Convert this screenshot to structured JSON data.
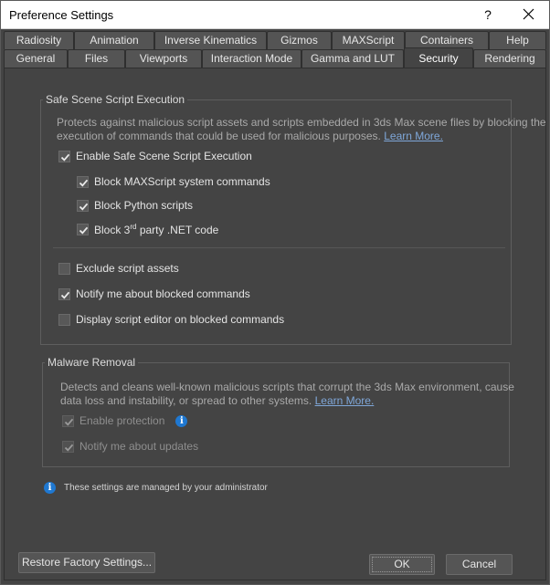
{
  "window": {
    "title": "Preference Settings",
    "help_label": "?"
  },
  "tabs": {
    "row1": [
      "Radiosity",
      "Animation",
      "Inverse Kinematics",
      "Gizmos",
      "MAXScript",
      "Containers",
      "Help"
    ],
    "row2": [
      "General",
      "Files",
      "Viewports",
      "Interaction Mode",
      "Gamma and LUT",
      "Security",
      "Rendering"
    ],
    "active": "Security"
  },
  "safe_scene": {
    "title": "Safe Scene Script Execution",
    "description_line1": "Protects against malicious script assets and scripts embedded in 3ds Max scene files by blocking the",
    "description_line2": "execution of commands that could be used for malicious purposes.",
    "learn_more": "Learn More.",
    "enable": {
      "label": "Enable Safe Scene Script Execution",
      "checked": true
    },
    "block_maxscript": {
      "label": "Block MAXScript system commands",
      "checked": true
    },
    "block_python": {
      "label": "Block Python scripts",
      "checked": true
    },
    "block_dotnet": {
      "label_pre": "Block 3",
      "label_sup": "rd",
      "label_post": " party .NET code",
      "checked": true
    },
    "exclude_assets": {
      "label": "Exclude script assets",
      "checked": false
    },
    "notify_blocked": {
      "label": "Notify me about blocked commands",
      "checked": true
    },
    "display_editor": {
      "label": "Display script editor on blocked commands",
      "checked": false
    }
  },
  "malware": {
    "title": "Malware Removal",
    "description_line1": "Detects and cleans well-known malicious scripts that corrupt the 3ds Max environment, cause",
    "description_line2": "data loss and instability, or spread to other systems.",
    "learn_more": "Learn More.",
    "enable_protection": {
      "label": "Enable protection",
      "checked": true,
      "enabled": false
    },
    "notify_updates": {
      "label": "Notify me about updates",
      "checked": true,
      "enabled": false
    }
  },
  "admin_note": "These settings are managed by your administrator",
  "buttons": {
    "restore": "Restore Factory Settings...",
    "ok": "OK",
    "cancel": "Cancel"
  },
  "icons": {
    "info_glyph": "i",
    "close": "close-icon",
    "check": "checkmark-icon"
  },
  "colors": {
    "background": "#444444",
    "info_blue": "#1f78d1",
    "link": "#7fa7d9"
  }
}
